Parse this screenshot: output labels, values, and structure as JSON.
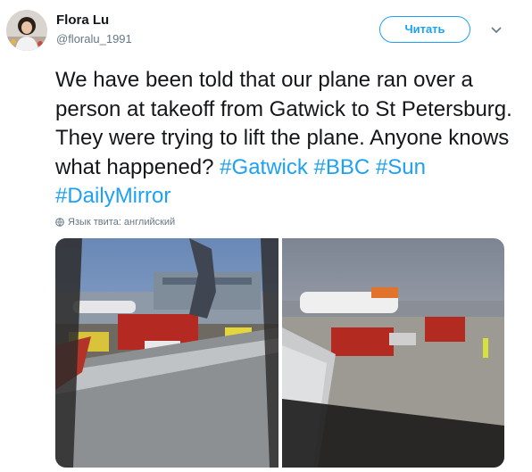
{
  "user": {
    "display_name": "Flora Lu",
    "handle": "@floralu_1991",
    "avatar_icon": "profile-photo"
  },
  "follow_button": {
    "label": "Читать"
  },
  "tweet": {
    "text": "We have been told that our plane ran over a person at takeoff from Gatwick to St Petersburg. They were trying to lift the plane. Anyone knows what happened?",
    "hashtags": [
      "#Gatwick",
      "#BBC",
      "#Sun",
      "#DailyMirror"
    ]
  },
  "language_note": "Язык твита: английский",
  "colors": {
    "link": "#1da1f2",
    "secondary": "#657786",
    "text": "#14171a"
  },
  "media": [
    {
      "description_icon": "airport-apron-photo-left"
    },
    {
      "description_icon": "airport-apron-photo-right"
    }
  ]
}
